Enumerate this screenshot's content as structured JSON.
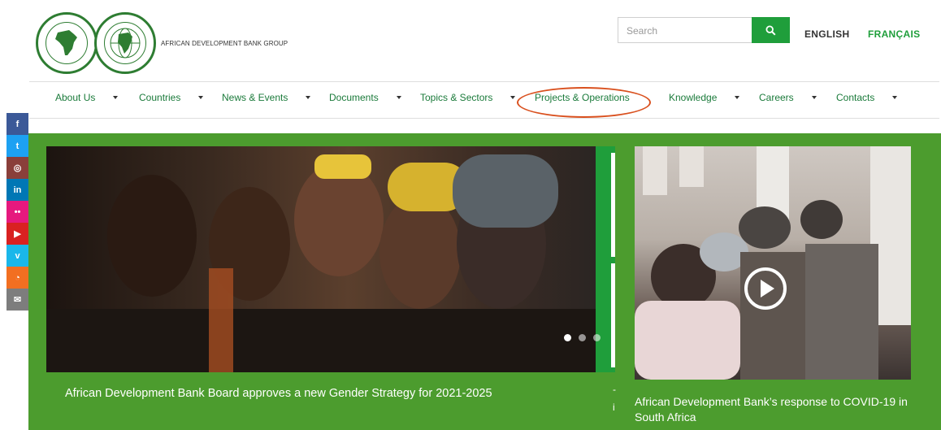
{
  "header": {
    "logo_text": "AFRICAN DEVELOPMENT BANK GROUP",
    "search_placeholder": "Search",
    "lang_en": "ENGLISH",
    "lang_fr": "FRANÇAIS",
    "brand_color": "#1f9e3b"
  },
  "nav": {
    "items": [
      {
        "label": "About Us"
      },
      {
        "label": "Countries"
      },
      {
        "label": "News & Events"
      },
      {
        "label": "Documents"
      },
      {
        "label": "Topics & Sectors"
      },
      {
        "label": "Projects & Operations"
      },
      {
        "label": "Knowledge"
      },
      {
        "label": "Careers"
      },
      {
        "label": "Contacts"
      }
    ],
    "highlighted": "Projects & Operations",
    "highlight_color": "#d9501e"
  },
  "social": [
    {
      "icon": "facebook-icon",
      "glyph": "f",
      "color": "#3b5998"
    },
    {
      "icon": "twitter-icon",
      "glyph": "t",
      "color": "#1da1f2"
    },
    {
      "icon": "instagram-icon",
      "glyph": "◎",
      "color": "#8a3f3a"
    },
    {
      "icon": "linkedin-icon",
      "glyph": "in",
      "color": "#0077b5"
    },
    {
      "icon": "flickr-icon",
      "glyph": "••",
      "color": "#e6197e"
    },
    {
      "icon": "youtube-icon",
      "glyph": "▶",
      "color": "#d92121"
    },
    {
      "icon": "vimeo-icon",
      "glyph": "v",
      "color": "#1ab7ea"
    },
    {
      "icon": "rss-icon",
      "glyph": "◔",
      "color": "#f26f21"
    },
    {
      "icon": "email-icon",
      "glyph": "✉",
      "color": "#7d7d7d"
    }
  ],
  "carousel": {
    "caption": "African Development Bank Board approves a new Gender Strategy for 2021-2025",
    "slide_count": 3,
    "active_slide": 1,
    "strip_mark_1": "-",
    "strip_mark_2": "i"
  },
  "video": {
    "caption": "African Development Bank’s response to COVID-19 in South Africa"
  },
  "band_color": "#4c9c2e"
}
